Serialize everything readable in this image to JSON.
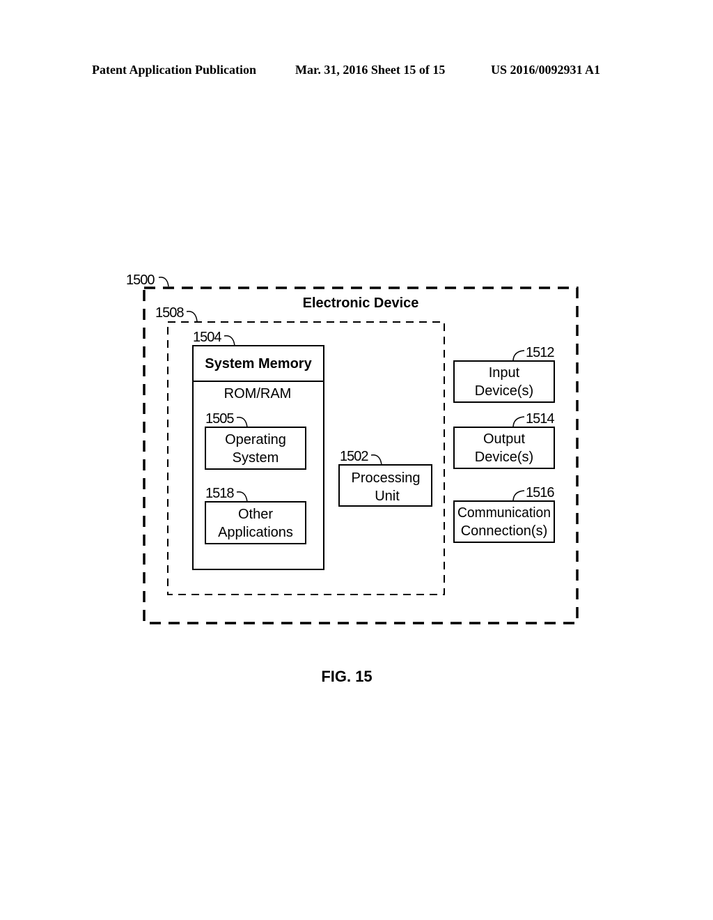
{
  "header": {
    "publication": "Patent Application Publication",
    "date_sheet": "Mar. 31, 2016  Sheet 15 of 15",
    "patent_number": "US 2016/0092931 A1"
  },
  "diagram": {
    "device": {
      "ref": "1500",
      "title": "Electronic Device"
    },
    "inner_group": {
      "ref": "1508"
    },
    "system_memory": {
      "ref": "1504",
      "title": "System Memory",
      "subtitle": "ROM/RAM",
      "operating_system": {
        "ref": "1505",
        "line1": "Operating",
        "line2": "System"
      },
      "other_applications": {
        "ref": "1518",
        "line1": "Other",
        "line2": "Applications"
      }
    },
    "processing_unit": {
      "ref": "1502",
      "line1": "Processing",
      "line2": "Unit"
    },
    "input_devices": {
      "ref": "1512",
      "line1": "Input",
      "line2": "Device(s)"
    },
    "output_devices": {
      "ref": "1514",
      "line1": "Output",
      "line2": "Device(s)"
    },
    "communication": {
      "ref": "1516",
      "line1": "Communication",
      "line2": "Connection(s)"
    }
  },
  "figure_label": "FIG. 15"
}
